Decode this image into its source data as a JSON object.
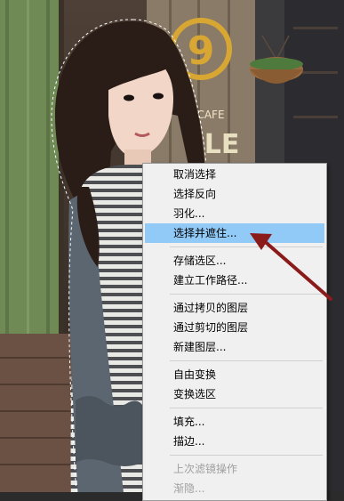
{
  "menu": {
    "groups": [
      {
        "items": [
          {
            "label": "取消选择"
          },
          {
            "label": "选择反向"
          },
          {
            "label": "羽化..."
          },
          {
            "label": "选择并遮住...",
            "highlighted": true
          }
        ]
      },
      {
        "items": [
          {
            "label": "存储选区..."
          },
          {
            "label": "建立工作路径..."
          }
        ]
      },
      {
        "items": [
          {
            "label": "通过拷贝的图层"
          },
          {
            "label": "通过剪切的图层"
          },
          {
            "label": "新建图层..."
          }
        ]
      },
      {
        "items": [
          {
            "label": "自由变换"
          },
          {
            "label": "变换选区"
          }
        ]
      },
      {
        "items": [
          {
            "label": "填充..."
          },
          {
            "label": "描边..."
          }
        ]
      },
      {
        "items": [
          {
            "label": "上次滤镜操作",
            "disabled": true
          },
          {
            "label": "渐隐...",
            "disabled": true
          }
        ]
      }
    ]
  },
  "photo": {
    "sign_number": "9",
    "sign_text_1": "CAFE",
    "sign_text_2": "LLE"
  },
  "colors": {
    "highlight": "#91c9f7",
    "annotation_arrow": "#8b1a1a",
    "door_green": "#6f8a55"
  }
}
